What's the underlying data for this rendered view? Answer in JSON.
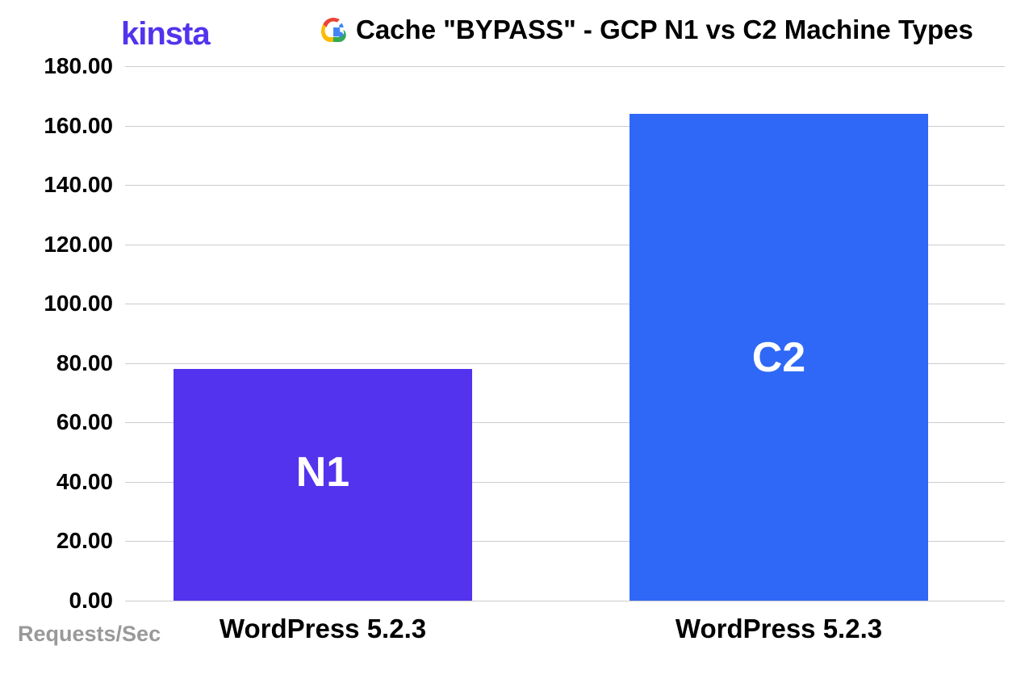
{
  "header": {
    "logo_text": "kinsta",
    "title": "Cache \"BYPASS\" - GCP N1 vs C2 Machine Types"
  },
  "chart_data": {
    "type": "bar",
    "title": "Cache \"BYPASS\" - GCP N1 vs C2 Machine Types",
    "ylabel": "Requests/Sec",
    "xlabel": "",
    "ylim": [
      0,
      180
    ],
    "yticks": [
      "0.00",
      "20.00",
      "40.00",
      "60.00",
      "80.00",
      "100.00",
      "120.00",
      "140.00",
      "160.00",
      "180.00"
    ],
    "categories": [
      "WordPress 5.2.3",
      "WordPress 5.2.3"
    ],
    "series": [
      {
        "name": "N1",
        "value": 78,
        "color": "#5333ED"
      },
      {
        "name": "C2",
        "value": 164,
        "color": "#2F68F6"
      }
    ]
  }
}
